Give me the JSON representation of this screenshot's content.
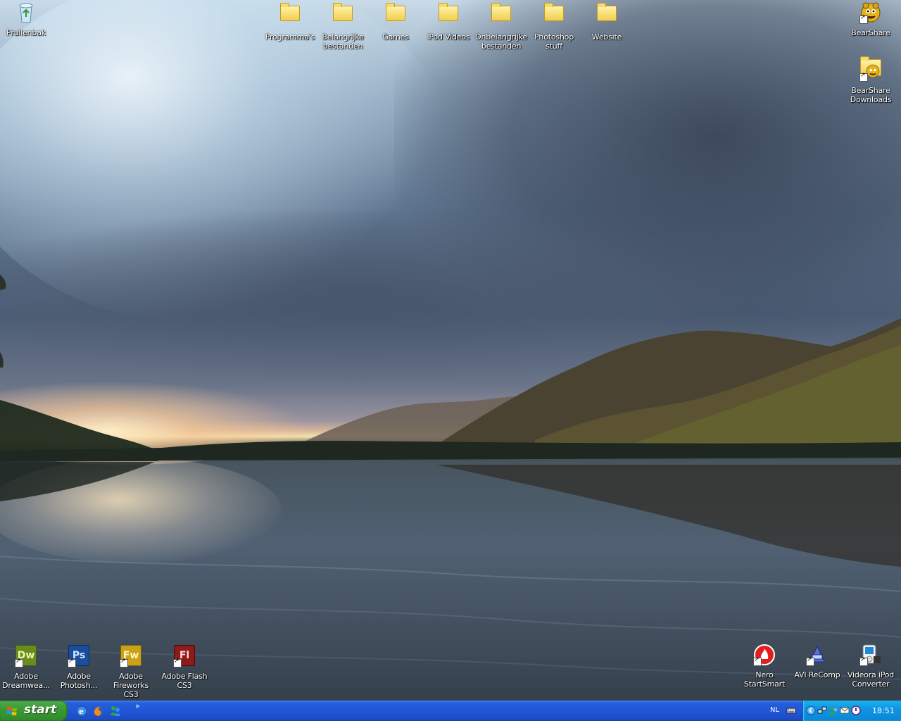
{
  "desktop": {
    "icons_top": [
      {
        "label": "Prullenbak",
        "type": "recycle-bin"
      },
      {
        "label": "Programma's",
        "type": "folder"
      },
      {
        "label": "Belangrijke bestanden",
        "type": "folder"
      },
      {
        "label": "Games",
        "type": "folder"
      },
      {
        "label": "iPod Videos",
        "type": "folder"
      },
      {
        "label": "Onbelangrijke bestanden",
        "type": "folder"
      },
      {
        "label": "Photoshop stuff",
        "type": "folder"
      },
      {
        "label": "Website",
        "type": "folder"
      }
    ],
    "icons_right": [
      {
        "label": "BearShare",
        "type": "bearshare-shortcut"
      },
      {
        "label": "BearShare Downloads",
        "type": "bearshare-folder-shortcut"
      }
    ],
    "icons_bottom_left": [
      {
        "label": "Adobe Dreamwea...",
        "abbr": "Dw",
        "color": "#6a8c1e",
        "text_color": "#e8f5b0"
      },
      {
        "label": "Adobe Photosh...",
        "abbr": "Ps",
        "color": "#1a4d9c",
        "text_color": "#cfe4ff"
      },
      {
        "label": "Adobe Fireworks CS3",
        "abbr": "Fw",
        "color": "#c9a218",
        "text_color": "#fff5c2"
      },
      {
        "label": "Adobe Flash CS3",
        "abbr": "Fl",
        "color": "#8e1a1a",
        "text_color": "#ffd9d9"
      }
    ],
    "icons_bottom_right": [
      {
        "label": "Nero StartSmart",
        "type": "nero"
      },
      {
        "label": "AVI ReComp",
        "type": "avi-recomp"
      },
      {
        "label": "Videora iPod Converter",
        "type": "videora"
      }
    ]
  },
  "taskbar": {
    "start_label": "start",
    "quick_launch": [
      "internet-explorer-icon",
      "firefox-icon",
      "messenger-icon"
    ],
    "more_label": "»",
    "language": "NL",
    "clock": "18:51",
    "colors": {
      "bar": "#245edc",
      "start": "#3c9a35",
      "tray": "#0f95e3"
    }
  }
}
